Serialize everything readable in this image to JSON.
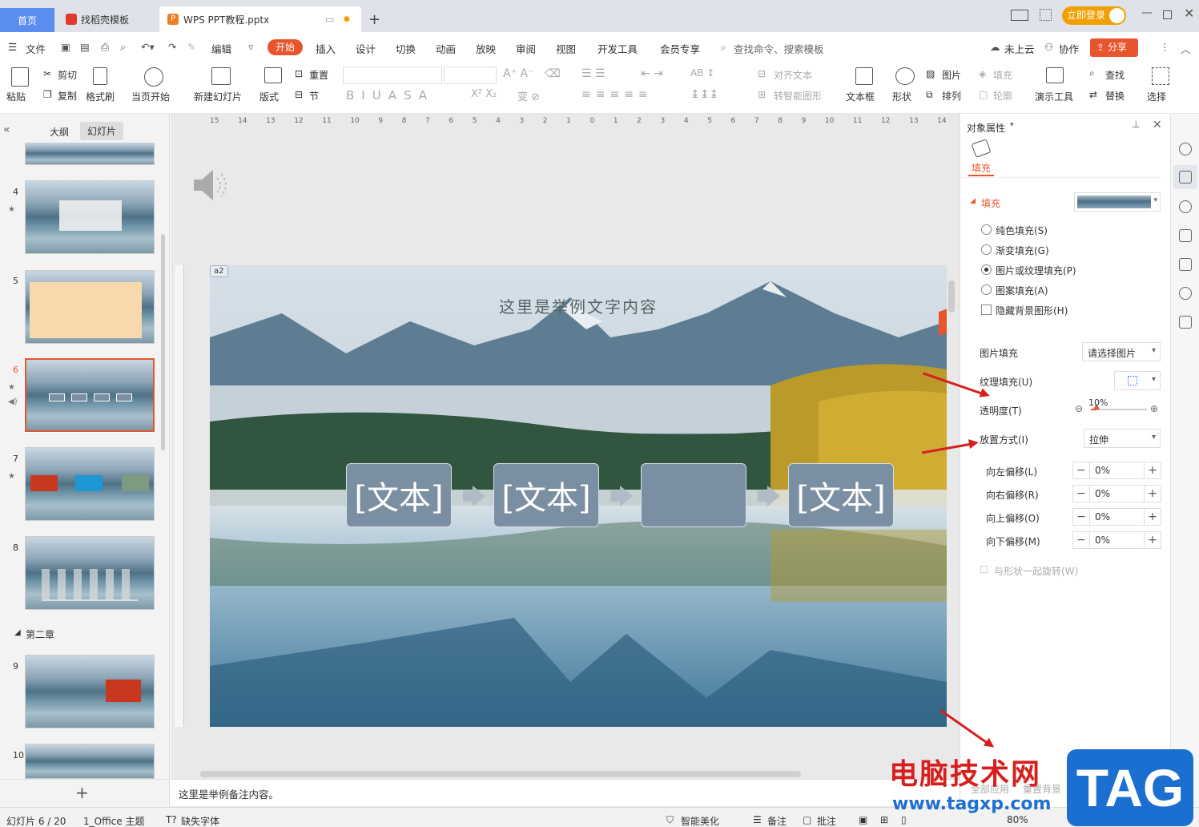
{
  "tabs": {
    "home": "首页",
    "template": "找稻壳模板",
    "doc": "WPS PPT教程.pptx",
    "new": "+",
    "login": "立即登录"
  },
  "menu": {
    "file": "文件",
    "edit": "编辑",
    "start": "开始",
    "insert": "插入",
    "design": "设计",
    "switch": "切换",
    "animation": "动画",
    "slideshow": "放映",
    "review": "审阅",
    "view": "视图",
    "devtools": "开发工具",
    "member": "会员专享",
    "search_placeholder": "查找命令、搜索模板",
    "cloud": "未上云",
    "collab": "协作",
    "share": "分享"
  },
  "ribbon": {
    "paste": "粘贴",
    "cut": "剪切",
    "copy": "复制",
    "format_painter": "格式刷",
    "from_current": "当页开始",
    "new_slide": "新建幻灯片",
    "layout": "版式",
    "reset": "重置",
    "section": "节",
    "align_text": "对齐文本",
    "smart_shape": "转智能图形",
    "textbox": "文本框",
    "shape": "形状",
    "picture": "图片",
    "arrange": "排列",
    "fill": "填充",
    "outline": "轮廓",
    "presenter_tools": "演示工具",
    "find": "查找",
    "replace": "替换",
    "select": "选择"
  },
  "left": {
    "outline_tab": "大纲",
    "slides_tab": "幻灯片",
    "section2": "第二章",
    "slide_numbers": [
      "4",
      "5",
      "6",
      "7",
      "8",
      "9",
      "10"
    ]
  },
  "ruler": {
    "marks": [
      "15",
      "14",
      "13",
      "12",
      "11",
      "10",
      "9",
      "8",
      "7",
      "6",
      "5",
      "4",
      "3",
      "2",
      "1",
      "0",
      "1",
      "2",
      "3",
      "4",
      "5",
      "6",
      "7",
      "8",
      "9",
      "10",
      "11",
      "12",
      "13",
      "14"
    ]
  },
  "slide": {
    "tag": "a2",
    "title": "这里是举例文字内容",
    "boxes": [
      "[文本]",
      "[文本]",
      "",
      "[文本]"
    ]
  },
  "notes": "这里是举例备注内容。",
  "right_panel": {
    "title": "对象属性",
    "fill_tab": "填充",
    "section_fill": "填充",
    "options": [
      "纯色填充(S)",
      "渐变填充(G)",
      "图片或纹理填充(P)",
      "图案填充(A)"
    ],
    "selected_option": "图片或纹理填充(P)",
    "hide_bg": "隐藏背景图形(H)",
    "picture_fill_label": "图片填充",
    "picture_fill_value": "请选择图片",
    "texture_fill_label": "纹理填充(U)",
    "transparency_label": "透明度(T)",
    "transparency_value": "10%",
    "transparency_fraction": 0.1,
    "placement_label": "放置方式(I)",
    "placement_value": "拉伸",
    "offsets": [
      {
        "label": "向左偏移(L)",
        "value": "0%"
      },
      {
        "label": "向右偏移(R)",
        "value": "0%"
      },
      {
        "label": "向上偏移(O)",
        "value": "0%"
      },
      {
        "label": "向下偏移(M)",
        "value": "0%"
      }
    ],
    "rotate_with_shape": "与形状一起旋转(W)",
    "apply_all": "全部应用",
    "reset_bg": "重置背景"
  },
  "status": {
    "slide_pos": "幻灯片 6 / 20",
    "theme": "1_Office 主题",
    "missing_font": "缺失字体",
    "beautify": "智能美化",
    "notes": "备注",
    "comments": "批注",
    "zoom": "80%"
  },
  "watermark": {
    "line1": "电脑技术网",
    "line2": "www.tagxp.com",
    "brand": "TAG"
  },
  "colors": {
    "accent": "#e8542d",
    "home_tab": "#5b8def",
    "box": "#7b8fa3"
  }
}
